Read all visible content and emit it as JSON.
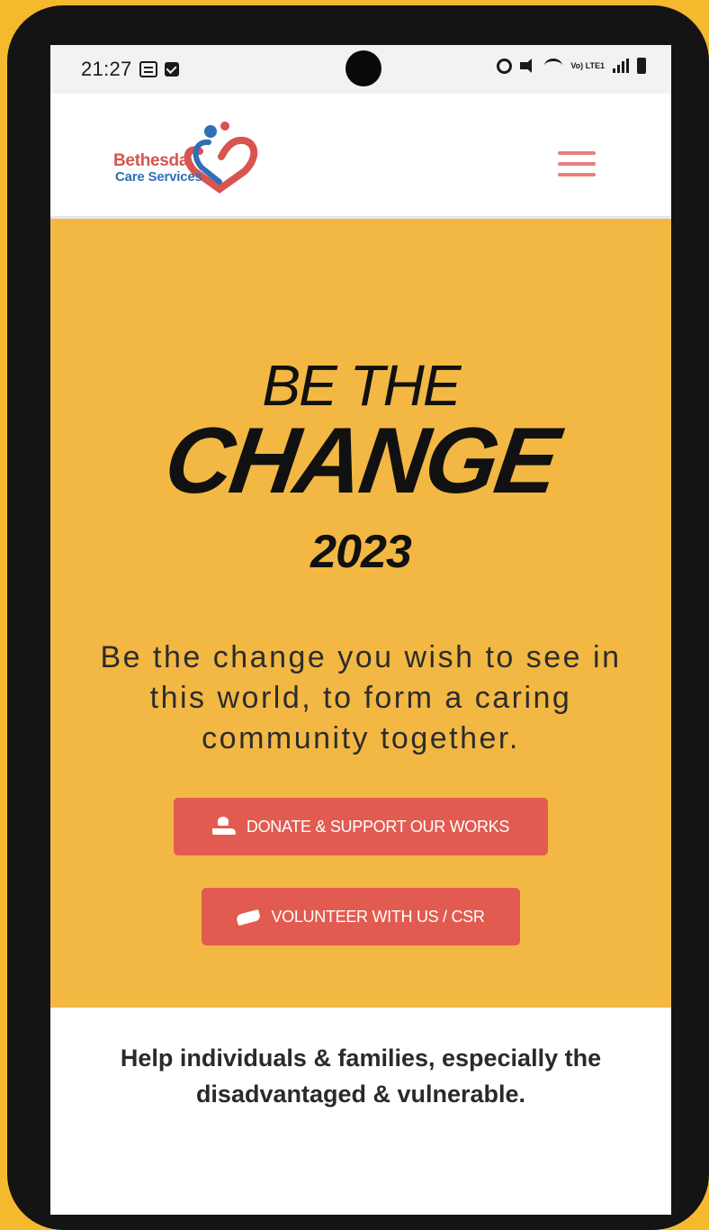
{
  "status_bar": {
    "time": "21:27",
    "lte_label": "Vo) LTE1"
  },
  "header": {
    "logo_line1": "Bethesda",
    "logo_line2": "Care Services",
    "brand_colors": {
      "red": "#d9534f",
      "blue": "#2f6fb5"
    },
    "menu_icon": "hamburger-menu-icon"
  },
  "hero": {
    "headline_top": "BE THE",
    "headline_main": "CHANGE",
    "headline_year": "2023",
    "tagline": "Be the change you wish to see in this world, to form a caring community together.",
    "background_color": "#f2b843",
    "buttons": {
      "donate_label": "DONATE & SUPPORT OUR WORKS",
      "donate_icon": "hand-heart-icon",
      "volunteer_label": "VOLUNTEER WITH US / CSR",
      "volunteer_icon": "handshake-icon",
      "button_color": "#e25b50"
    }
  },
  "mission": {
    "text": "Help individuals & families, especially the disadvantaged & vulnerable."
  }
}
